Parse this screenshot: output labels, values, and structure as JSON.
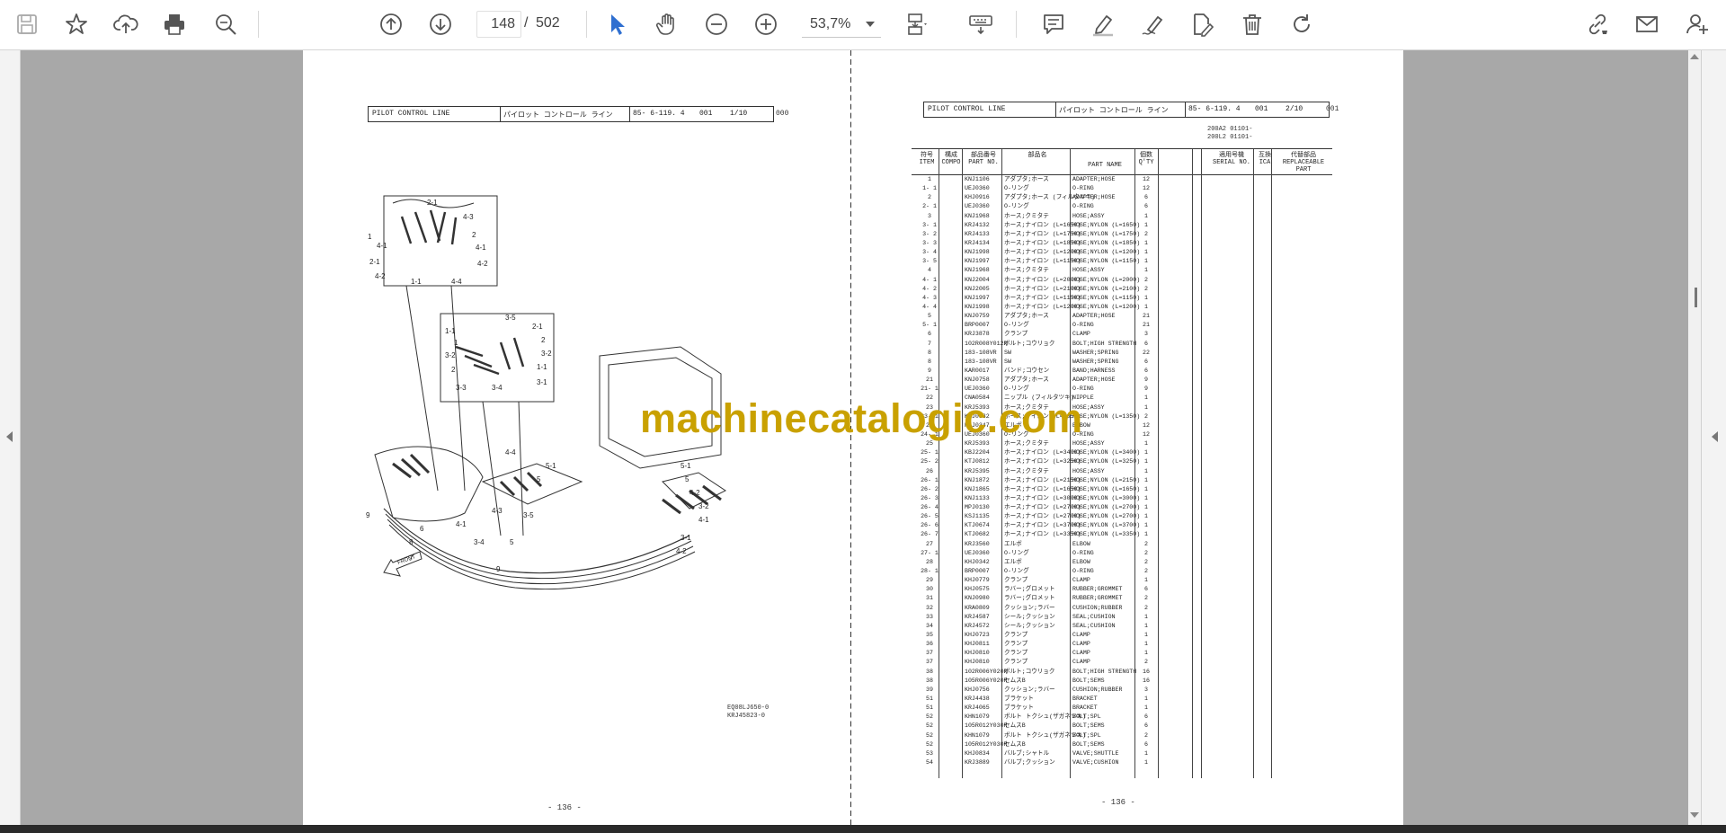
{
  "toolbar": {
    "page_current": "148",
    "page_separator": "/",
    "page_total": "502",
    "zoom": "53,7%"
  },
  "icons": [
    "save-icon",
    "star-icon",
    "upload-icon",
    "print-icon",
    "zoom-search-icon",
    "page-up-icon",
    "page-down-icon",
    "select-cursor-icon",
    "hand-icon",
    "zoom-out-icon",
    "zoom-in-icon",
    "fit-page-icon",
    "keyboard-icon",
    "comment-icon",
    "highlight-icon",
    "sign-icon",
    "edit-pdf-icon",
    "delete-icon",
    "redo-icon",
    "share-link-icon",
    "email-icon",
    "add-user-icon"
  ],
  "left_page": {
    "header": {
      "title_en": "PILOT CONTROL LINE",
      "title_jp": "パイロット コントロール ライン",
      "code": "85-  6-119. 4",
      "num": "001",
      "sheet": "1/10",
      "suffix": "000"
    },
    "drawing_codes": [
      "EQ08LJ650-0",
      "KRJ45823-0"
    ],
    "footer": "- 136 -"
  },
  "right_page": {
    "header": {
      "title_en": "PILOT CONTROL LINE",
      "title_jp": "パイロット コントロール ライン",
      "code": "85-  6-119. 4",
      "num": "001",
      "sheet": "2/10",
      "suffix": "001"
    },
    "serial_range": [
      "200A2 01101-",
      "200L2 01101-"
    ],
    "columns": {
      "item": "符号\nITEM",
      "compo": "構成\nCOMPO",
      "part_no": "部品番号\nPART NO.",
      "jp_name": "部品名",
      "part_name": "PART NAME",
      "qty": "個数\nQ'TY",
      "serial": "適用号機\nSERIAL NO.",
      "ica": "互換\nICA",
      "replaceable": "代替部品\nREPLACEABLE\nPART"
    },
    "rows": [
      [
        "1",
        "KNJ1106",
        "アダプタ;ホース",
        "ADAPTER;HOSE",
        "12"
      ],
      [
        "1- 1",
        "UEJ0360",
        "O-リング",
        "O-RING",
        "12"
      ],
      [
        "2",
        "KHJ0916",
        "アダプタ;ホース (フィルタツキ)",
        "ADAPTER;HOSE",
        "6"
      ],
      [
        "2- 1",
        "UEJ0360",
        "O-リング",
        "O-RING",
        "6"
      ],
      [
        "3",
        "KNJ1968",
        "ホース;クミタテ",
        "HOSE;ASSY",
        "1"
      ],
      [
        "3- 1",
        "KRJ4132",
        "ホース;ナイロン (L=1650)",
        "HOSE;NYLON (L=1650)",
        "1"
      ],
      [
        "3- 2",
        "KRJ4133",
        "ホース;ナイロン (L=1750)",
        "HOSE;NYLON (L=1750)",
        "2"
      ],
      [
        "3- 3",
        "KRJ4134",
        "ホース;ナイロン (L=1850)",
        "HOSE;NYLON (L=1850)",
        "1"
      ],
      [
        "3- 4",
        "KNJ1998",
        "ホース;ナイロン (L=1200)",
        "HOSE;NYLON (L=1200)",
        "1"
      ],
      [
        "3- 5",
        "KNJ1997",
        "ホース;ナイロン (L=1150)",
        "HOSE;NYLON (L=1150)",
        "1"
      ],
      [
        "4",
        "KNJ1968",
        "ホース;クミタテ",
        "HOSE;ASSY",
        "1"
      ],
      [
        "4- 1",
        "KNJ2004",
        "ホース;ナイロン (L=2000)",
        "HOSE;NYLON (L=2000)",
        "2"
      ],
      [
        "4- 2",
        "KNJ2005",
        "ホース;ナイロン (L=2100)",
        "HOSE;NYLON (L=2100)",
        "2"
      ],
      [
        "4- 3",
        "KNJ1997",
        "ホース;ナイロン (L=1150)",
        "HOSE;NYLON (L=1150)",
        "1"
      ],
      [
        "4- 4",
        "KNJ1998",
        "ホース;ナイロン (L=1200)",
        "HOSE;NYLON (L=1200)",
        "1"
      ],
      [
        "5",
        "KNJ0759",
        "アダプタ;ホース",
        "ADAPTER;HOSE",
        "21"
      ],
      [
        "5- 1",
        "BRP0007",
        "O-リング",
        "O-RING",
        "21"
      ],
      [
        "6",
        "KRJ3878",
        "クランプ",
        "CLAMP",
        "3"
      ],
      [
        "7",
        "102R008Y012R",
        "ボルト;コウリョク",
        "BOLT;HIGH STRENGTH",
        "6"
      ],
      [
        "8",
        "183-108VR",
        "SW",
        "WASHER;SPRING",
        "22"
      ],
      [
        "8",
        "183-108VR",
        "SW",
        "WASHER;SPRING",
        "6"
      ],
      [
        "9",
        "KAR0017",
        "バンド;コウセン",
        "BAND;HARNESS",
        "6"
      ],
      [
        "21",
        "KNJ0758",
        "アダプタ;ホース",
        "ADAPTER;HOSE",
        "9"
      ],
      [
        "21- 1",
        "UEJ0360",
        "O-リング",
        "O-RING",
        "9"
      ],
      [
        "22",
        "CNA0584",
        "ニップル (フィルタツキ)",
        "NIPPLE",
        "1"
      ],
      [
        "23",
        "KRJ5393",
        "ホース;クミタテ",
        "HOSE;ASSY",
        "1"
      ],
      [
        "23- 1",
        "KTJ0682",
        "ホース;ナイロン (L=1350)",
        "HOSE;NYLON (L=1350)",
        "2"
      ],
      [
        "24",
        "KHJ0347",
        "エルボ",
        "ELBOW",
        "12"
      ],
      [
        "24- 1",
        "UEJ0360",
        "O-リング",
        "O-RING",
        "12"
      ],
      [
        "25",
        "KRJ5393",
        "ホース;クミタテ",
        "HOSE;ASSY",
        "1"
      ],
      [
        "25- 1",
        "KBJ2204",
        "ホース;ナイロン (L=3400)",
        "HOSE;NYLON (L=3400)",
        "1"
      ],
      [
        "25- 2",
        "KTJ0812",
        "ホース;ナイロン (L=3250)",
        "HOSE;NYLON (L=3250)",
        "1"
      ],
      [
        "26",
        "KRJ5395",
        "ホース;クミタテ",
        "HOSE;ASSY",
        "1"
      ],
      [
        "26- 1",
        "KNJ1872",
        "ホース;ナイロン (L=2150)",
        "HOSE;NYLON (L=2150)",
        "1"
      ],
      [
        "26- 2",
        "KNJ1865",
        "ホース;ナイロン (L=1650)",
        "HOSE;NYLON (L=1650)",
        "1"
      ],
      [
        "26- 3",
        "KNJ1133",
        "ホース;ナイロン (L=3000)",
        "HOSE;NYLON (L=3000)",
        "1"
      ],
      [
        "26- 4",
        "MPJ0130",
        "ホース;ナイロン (L=2700)",
        "HOSE;NYLON (L=2700)",
        "1"
      ],
      [
        "26- 5",
        "KSJ1135",
        "ホース;ナイロン (L=2700)",
        "HOSE;NYLON (L=2700)",
        "1"
      ],
      [
        "26- 6",
        "KTJ0674",
        "ホース;ナイロン (L=3700)",
        "HOSE;NYLON (L=3700)",
        "1"
      ],
      [
        "26- 7",
        "KTJ0682",
        "ホース;ナイロン (L=3350)",
        "HOSE;NYLON (L=3350)",
        "1"
      ],
      [
        "27",
        "KRJ3560",
        "エルボ",
        "ELBOW",
        "2"
      ],
      [
        "27- 1",
        "UEJ0360",
        "O-リング",
        "O-RING",
        "2"
      ],
      [
        "28",
        "KHJ0342",
        "エルボ",
        "ELBOW",
        "2"
      ],
      [
        "28- 1",
        "BRP0007",
        "O-リング",
        "O-RING",
        "2"
      ],
      [
        "29",
        "KHJ0779",
        "クランプ",
        "CLAMP",
        "1"
      ],
      [
        "30",
        "KHJ0575",
        "ラバー;グロメット",
        "RUBBER;GROMMET",
        "6"
      ],
      [
        "31",
        "KNJ0980",
        "ラバー;グロメット",
        "RUBBER;GROMMET",
        "2"
      ],
      [
        "32",
        "KRA0809",
        "クッション;ラバー",
        "CUSHION;RUBBER",
        "2"
      ],
      [
        "33",
        "KRJ4587",
        "シール;クッション",
        "SEAL;CUSHION",
        "1"
      ],
      [
        "34",
        "KRJ4572",
        "シール;クッション",
        "SEAL;CUSHION",
        "1"
      ],
      [
        "35",
        "KHJ0723",
        "クランプ",
        "CLAMP",
        "1"
      ],
      [
        "36",
        "KHJ0811",
        "クランプ",
        "CLAMP",
        "1"
      ],
      [
        "37",
        "KHJ0810",
        "クランプ",
        "CLAMP",
        "1"
      ],
      [
        "37",
        "KHJ0810",
        "クランプ",
        "CLAMP",
        "2"
      ],
      [
        "38",
        "102R006Y020R",
        "ボルト;コウリョク",
        "BOLT;HIGH STRENGTH",
        "16"
      ],
      [
        "38",
        "105R006Y020R",
        "セムスB",
        "BOLT;SEMS",
        "16"
      ],
      [
        "39",
        "KHJ0756",
        "クッション;ラバー",
        "CUSHION;RUBBER",
        "3"
      ],
      [
        "51",
        "KRJ4438",
        "ブラケット",
        "BRACKET",
        "1"
      ],
      [
        "51",
        "KRJ4065",
        "ブラケット",
        "BRACKET",
        "1"
      ],
      [
        "52",
        "KHN1079",
        "ボルト トクシュ(ザガネツキ)",
        "BOLT;SPL",
        "6"
      ],
      [
        "52",
        "105R012Y030R",
        "セムスB",
        "BOLT;SEMS",
        "6"
      ],
      [
        "52",
        "KHN1079",
        "ボルト トクシュ(ザガネツキ)",
        "BOLT;SPL",
        "2"
      ],
      [
        "52",
        "105R012Y030R",
        "セムスB",
        "BOLT;SEMS",
        "6"
      ],
      [
        "53",
        "KHJ0834",
        "バルブ;シャトル",
        "VALVE;SHUTTLE",
        "1"
      ],
      [
        "54",
        "KRJ3889",
        "バルブ;クッション",
        "VALVE;CUSHION",
        "1"
      ]
    ],
    "footer": "- 136 -"
  },
  "watermark": "machinecatalogic.com",
  "colors": {
    "accent": "#2f6fd0",
    "watermark": "#c9a100"
  }
}
